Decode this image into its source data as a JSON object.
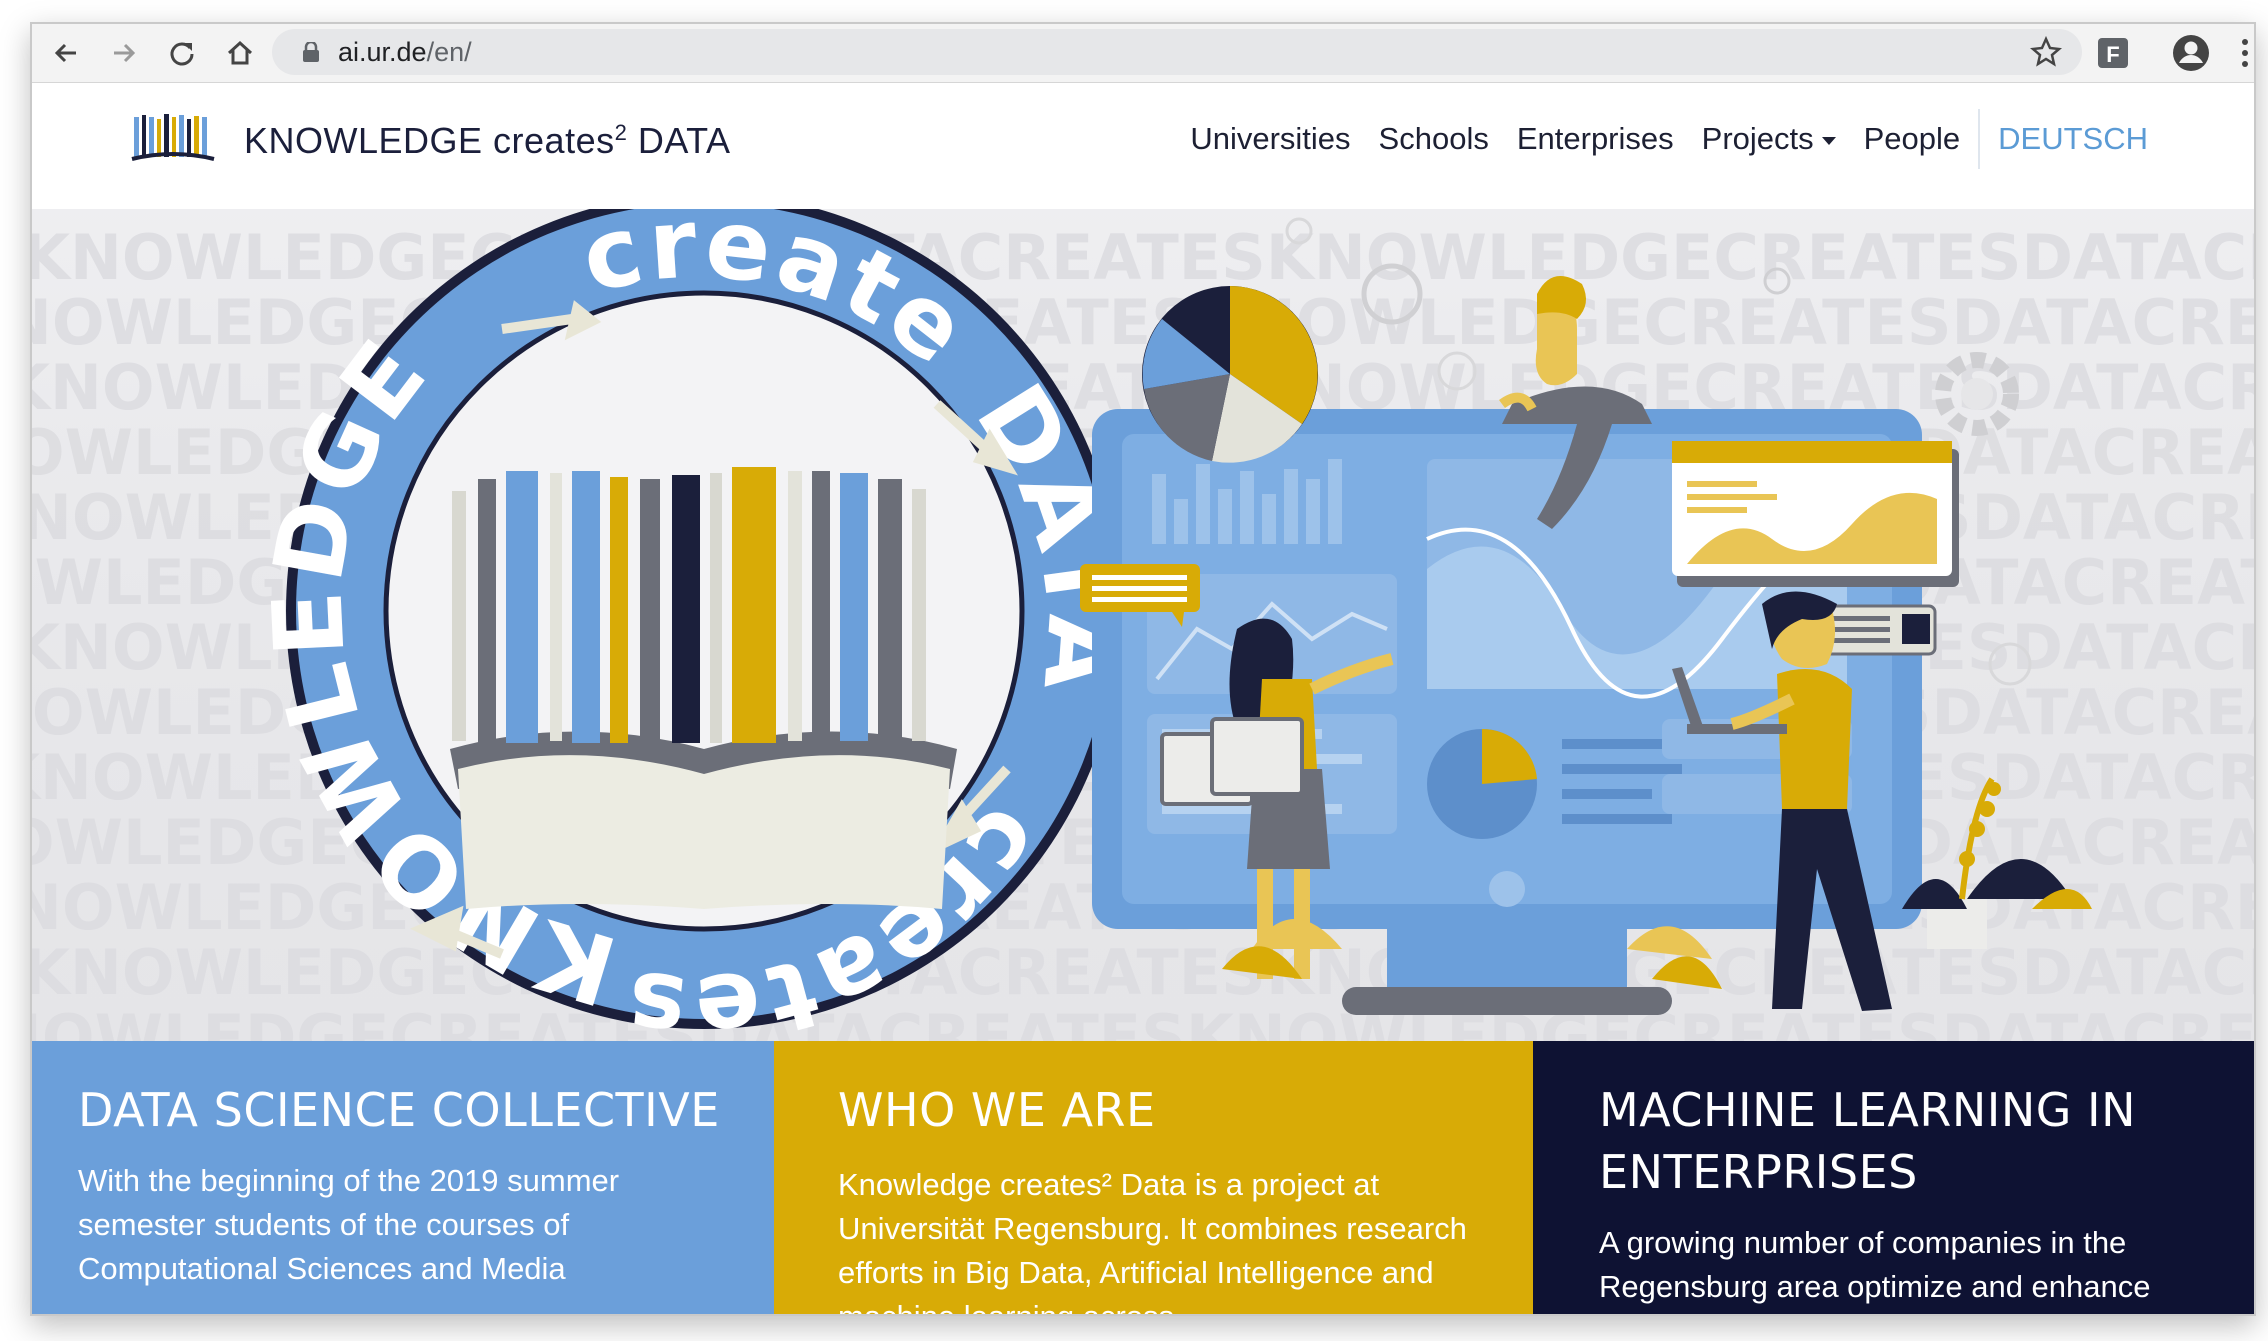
{
  "browser": {
    "url_host": "ai.ur.de",
    "url_path": "/en/",
    "extension_letter": "F"
  },
  "site": {
    "brand_prefix": "KNOWLEDGE creates",
    "brand_sup": "2",
    "brand_suffix": " DATA",
    "nav": {
      "universities": "Universities",
      "schools": "Schools",
      "enterprises": "Enterprises",
      "projects": "Projects",
      "people": "People",
      "language": "DEUTSCH"
    }
  },
  "hero": {
    "badge_top": "KNOWLEDGE",
    "badge_creates_top": "creates",
    "badge_data": "DATA",
    "badge_creates_bottom": "creates",
    "background_words": "KNOWLEDGECREATESDATACREATES"
  },
  "cards": [
    {
      "title": "DATA SCIENCE COLLECTIVE",
      "text": "With the beginning of the 2019 summer semester students of the courses of Computational Sciences and Media",
      "color": "#6b9fda"
    },
    {
      "title": "WHO WE ARE",
      "text": "Knowledge creates² Data is a project at Universität Regensburg. It combines research efforts in Big Data, Artificial Intelligence and machine learning across",
      "color": "#d8ab06"
    },
    {
      "title": "MACHINE LEARNING IN ENTERPRISES",
      "text": "A growing number of companies in the Regensburg area optimize and enhance their productivity by using Artificial",
      "color": "#0e1233"
    }
  ],
  "colors": {
    "blue": "#6b9fda",
    "gold": "#d8ab06",
    "navy": "#0e1233",
    "link_blue": "#5b9bd5"
  },
  "icons": [
    "back-arrow-icon",
    "forward-arrow-icon",
    "reload-icon",
    "home-icon",
    "lock-icon",
    "star-icon",
    "extension-icon",
    "profile-icon",
    "kebab-menu-icon",
    "logo-books-icon",
    "dropdown-caret-icon"
  ]
}
